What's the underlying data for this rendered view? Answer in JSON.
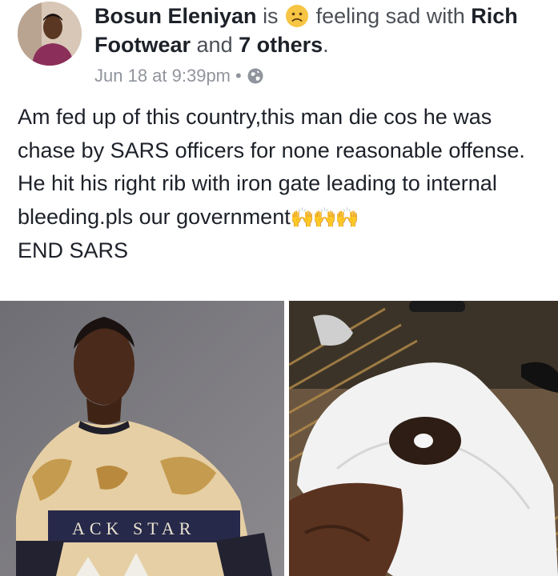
{
  "post": {
    "author": "Bosun Eleniyan",
    "is_word": "is",
    "feeling": "feeling sad with",
    "tagged_name": "Rich Footwear",
    "and_word": "and",
    "others": "7 others",
    "period": ".",
    "timestamp": "Jun 18 at 9:39pm",
    "separator": "•",
    "privacy_icon": "globe-icon",
    "feeling_icon": "sad-face-icon",
    "text_lines": [
      "Am fed up of this country,this man die cos he was chase by SARS officers for none reasonable offense.",
      "He hit his right rib with iron gate leading to internal bleeding.pls our government",
      "END SARS"
    ],
    "hands_emoji": "🙌🙌🙌"
  },
  "photos": {
    "left_shirt_text": "ACK STAR"
  },
  "colors": {
    "text": "#1d2129",
    "secondary": "#4b4f56",
    "meta": "#90949c",
    "emoji": "#f7c544"
  }
}
